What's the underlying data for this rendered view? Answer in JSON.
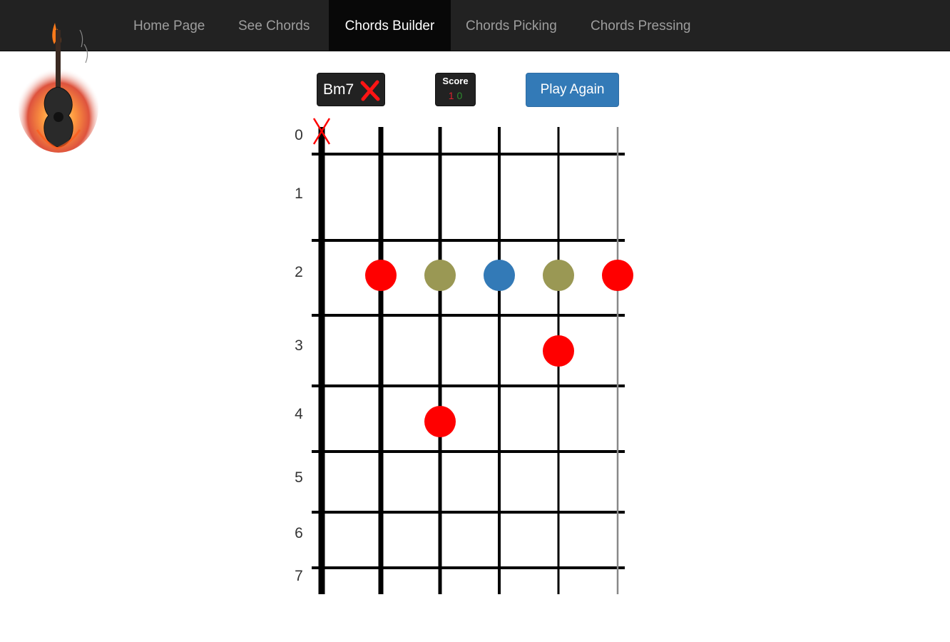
{
  "nav": {
    "items": [
      {
        "label": "Home Page",
        "active": false
      },
      {
        "label": "See Chords",
        "active": false
      },
      {
        "label": "Chords Builder",
        "active": true
      },
      {
        "label": "Chords Picking",
        "active": false
      },
      {
        "label": "Chords Pressing",
        "active": false
      }
    ]
  },
  "logo": {
    "icon": "flaming-guitar-logo"
  },
  "chord": {
    "name": "Bm7",
    "status_icon": "wrong-x-icon"
  },
  "score": {
    "label": "Score",
    "wrong": "1",
    "right": "0"
  },
  "actions": {
    "play_again": "Play Again"
  },
  "fretboard": {
    "fret_numbers": [
      "0",
      "1",
      "2",
      "3",
      "4",
      "5",
      "6",
      "7"
    ],
    "muted_strings": [
      1
    ],
    "dots": [
      {
        "string": 2,
        "fret": 2,
        "color": "#ff0000"
      },
      {
        "string": 3,
        "fret": 2,
        "color": "#9a9854"
      },
      {
        "string": 4,
        "fret": 2,
        "color": "#337ab7"
      },
      {
        "string": 5,
        "fret": 2,
        "color": "#9a9854"
      },
      {
        "string": 6,
        "fret": 2,
        "color": "#ff0000"
      },
      {
        "string": 5,
        "fret": 3,
        "color": "#ff0000"
      },
      {
        "string": 3,
        "fret": 4,
        "color": "#ff0000"
      }
    ]
  },
  "colors": {
    "navbar": "#222222",
    "active_tab": "#080808",
    "primary": "#337ab7",
    "wrong": "#ff0000",
    "neutral_dot": "#9a9854"
  }
}
